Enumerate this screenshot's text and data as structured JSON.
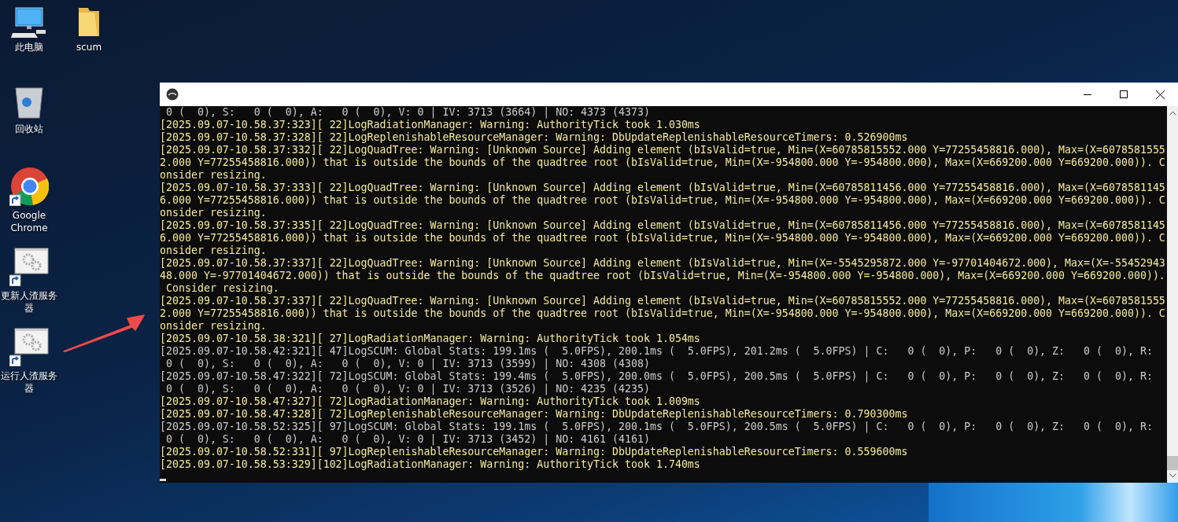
{
  "desktop_icons": [
    {
      "kind": "computer",
      "label": "此电脑"
    },
    {
      "kind": "folder",
      "label": "scum"
    },
    {
      "kind": "recycle-bin",
      "label": "回收站"
    },
    {
      "kind": "browser",
      "label": "Google Chrome"
    },
    {
      "kind": "gears",
      "label": "更新人渣服务器"
    },
    {
      "kind": "gears",
      "label": "运行人渣服务器"
    }
  ],
  "console": {
    "lines": [
      {
        "kind": "log",
        "text": " 0 (  0), S:   0 (  0), A:   0 (  0), V: 0 | IV: 3713 (3664) | NO: 4373 (4373)"
      },
      {
        "kind": "warning",
        "text": "[2025.09.07-10.58.37:323][ 22]LogRadiationManager: Warning: AuthorityTick took 1.030ms"
      },
      {
        "kind": "warning",
        "text": "[2025.09.07-10.58.37:328][ 22]LogReplenishableResourceManager: Warning: DbUpdateReplenishableResourceTimers: 0.526900ms"
      },
      {
        "kind": "warning",
        "text": "[2025.09.07-10.58.37:332][ 22]LogQuadTree: Warning: [Unknown Source] Adding element (bIsValid=true, Min=(X=60785815552.000 Y=77255458816.000), Max=(X=6078581555"
      },
      {
        "kind": "warning",
        "text": "2.000 Y=77255458816.000)) that is outside the bounds of the quadtree root (bIsValid=true, Min=(X=-954800.000 Y=-954800.000), Max=(X=669200.000 Y=669200.000)). C"
      },
      {
        "kind": "warning",
        "text": "onsider resizing."
      },
      {
        "kind": "warning",
        "text": "[2025.09.07-10.58.37:333][ 22]LogQuadTree: Warning: [Unknown Source] Adding element (bIsValid=true, Min=(X=60785811456.000 Y=77255458816.000), Max=(X=6078581145"
      },
      {
        "kind": "warning",
        "text": "6.000 Y=77255458816.000)) that is outside the bounds of the quadtree root (bIsValid=true, Min=(X=-954800.000 Y=-954800.000), Max=(X=669200.000 Y=669200.000)). C"
      },
      {
        "kind": "warning",
        "text": "onsider resizing."
      },
      {
        "kind": "warning",
        "text": "[2025.09.07-10.58.37:335][ 22]LogQuadTree: Warning: [Unknown Source] Adding element (bIsValid=true, Min=(X=60785811456.000 Y=77255458816.000), Max=(X=6078581145"
      },
      {
        "kind": "warning",
        "text": "6.000 Y=77255458816.000)) that is outside the bounds of the quadtree root (bIsValid=true, Min=(X=-954800.000 Y=-954800.000), Max=(X=669200.000 Y=669200.000)). C"
      },
      {
        "kind": "warning",
        "text": "onsider resizing."
      },
      {
        "kind": "warning",
        "text": "[2025.09.07-10.58.37:337][ 22]LogQuadTree: Warning: [Unknown Source] Adding element (bIsValid=true, Min=(X=-5545295872.000 Y=-97701404672.000), Max=(X=-55452943"
      },
      {
        "kind": "warning",
        "text": "48.000 Y=-97701404672.000)) that is outside the bounds of the quadtree root (bIsValid=true, Min=(X=-954800.000 Y=-954800.000), Max=(X=669200.000 Y=669200.000))."
      },
      {
        "kind": "warning",
        "text": " Consider resizing."
      },
      {
        "kind": "warning",
        "text": "[2025.09.07-10.58.37:337][ 22]LogQuadTree: Warning: [Unknown Source] Adding element (bIsValid=true, Min=(X=60785815552.000 Y=77255458816.000), Max=(X=6078581555"
      },
      {
        "kind": "warning",
        "text": "2.000 Y=77255458816.000)) that is outside the bounds of the quadtree root (bIsValid=true, Min=(X=-954800.000 Y=-954800.000), Max=(X=669200.000 Y=669200.000)). C"
      },
      {
        "kind": "warning",
        "text": "onsider resizing."
      },
      {
        "kind": "warning",
        "text": "[2025.09.07-10.58.38:321][ 27]LogRadiationManager: Warning: AuthorityTick took 1.054ms"
      },
      {
        "kind": "log",
        "text": "[2025.09.07-10.58.42:321][ 47]LogSCUM: Global Stats: 199.1ms (  5.0FPS), 200.1ms (  5.0FPS), 201.2ms (  5.0FPS) | C:   0 (  0), P:   0 (  0), Z:   0 (  0), R:"
      },
      {
        "kind": "log",
        "text": " 0 (  0), S:   0 (  0), A:   0 (  0), V: 0 | IV: 3713 (3599) | NO: 4308 (4308)"
      },
      {
        "kind": "log",
        "text": "[2025.09.07-10.58.47:322][ 72]LogSCUM: Global Stats: 199.4ms (  5.0FPS), 200.0ms (  5.0FPS), 200.5ms (  5.0FPS) | C:   0 (  0), P:   0 (  0), Z:   0 (  0), R:"
      },
      {
        "kind": "log",
        "text": " 0 (  0), S:   0 (  0), A:   0 (  0), V: 0 | IV: 3713 (3526) | NO: 4235 (4235)"
      },
      {
        "kind": "warning",
        "text": "[2025.09.07-10.58.47:327][ 72]LogRadiationManager: Warning: AuthorityTick took 1.009ms"
      },
      {
        "kind": "warning",
        "text": "[2025.09.07-10.58.47:328][ 72]LogReplenishableResourceManager: Warning: DbUpdateReplenishableResourceTimers: 0.790300ms"
      },
      {
        "kind": "log",
        "text": "[2025.09.07-10.58.52:325][ 97]LogSCUM: Global Stats: 199.1ms (  5.0FPS), 200.1ms (  5.0FPS), 200.5ms (  5.0FPS) | C:   0 (  0), P:   0 (  0), Z:   0 (  0), R:"
      },
      {
        "kind": "log",
        "text": " 0 (  0), S:   0 (  0), A:   0 (  0), V: 0 | IV: 3713 (3452) | NO: 4161 (4161)"
      },
      {
        "kind": "warning",
        "text": "[2025.09.07-10.58.52:331][ 97]LogReplenishableResourceManager: Warning: DbUpdateReplenishableResourceTimers: 0.559600ms"
      },
      {
        "kind": "warning",
        "text": "[2025.09.07-10.58.53:329][102]LogRadiationManager: Warning: AuthorityTick took 1.740ms"
      }
    ]
  }
}
